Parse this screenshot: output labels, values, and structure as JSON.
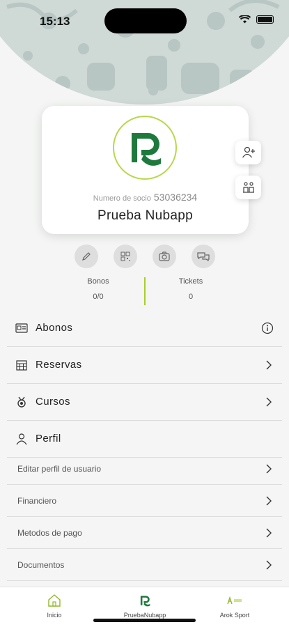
{
  "status_bar": {
    "time": "15:13"
  },
  "card": {
    "socio_label": "Numero de socio",
    "socio_number": "53036234",
    "name": "Prueba Nubapp"
  },
  "stats": [
    {
      "label": "Bonos",
      "value": "0/0"
    },
    {
      "label": "Tickets",
      "value": "0"
    }
  ],
  "menu": {
    "abonos": "Abonos",
    "reservas": "Reservas",
    "cursos": "Cursos",
    "perfil": "Perfil"
  },
  "profile_items": [
    "Editar perfil de usuario",
    "Financiero",
    "Metodos de pago",
    "Documentos"
  ],
  "tabs": [
    {
      "label": "Inicio",
      "icon": "home-icon"
    },
    {
      "label": "PruebaNubapp",
      "icon": "club-logo-icon"
    },
    {
      "label": "Arok Sport",
      "icon": "arok-sport-icon"
    }
  ],
  "colors": {
    "accent": "#a6cf2b",
    "brand_green": "#1e7a3c"
  }
}
